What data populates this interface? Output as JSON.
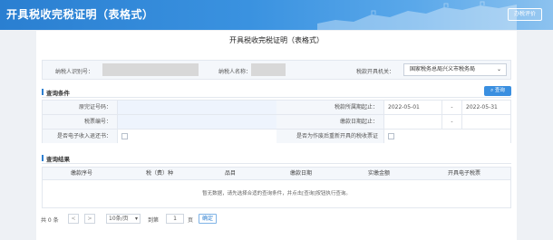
{
  "header": {
    "title": "开具税收完税证明（表格式）",
    "eval_button": "办税评价"
  },
  "page": {
    "title": "开具税收完税证明（表格式）"
  },
  "taxpayer": {
    "id_label": "纳税人识别号：",
    "name_label": "纳税人名称：",
    "org_label": "税款开具机关：",
    "org_value": "国家税务总局兴义市税务局"
  },
  "query": {
    "section_title": "查询条件",
    "button_label": "查询",
    "original_cert_label": "原完证号码：",
    "tax_period_label": "税款所属期起止：",
    "period_start": "2022-05-01",
    "period_sep": "-",
    "period_end": "2022-05-31",
    "tax_no_label": "税票编号：",
    "payment_date_label": "缴款日期起止：",
    "payment_sep": "-",
    "electronic_refund_label": "是否电子收入退还书：",
    "reissue_label": "是否为作废后重新开具的税收票证"
  },
  "results": {
    "section_title": "查询结果",
    "columns": [
      "缴款序号",
      "税（费）种",
      "品目",
      "缴款日期",
      "实缴金额",
      "开具电子税票"
    ],
    "empty_text": "暂无数据，请先选择合适的查询条件，并点击[查询]按钮执行查询。"
  },
  "pager": {
    "total": "共 0 条",
    "prev": "<",
    "next": ">",
    "page_size": "10条/页",
    "goto_label": "到第",
    "page_value": "1",
    "page_unit": "页",
    "confirm": "确定"
  }
}
